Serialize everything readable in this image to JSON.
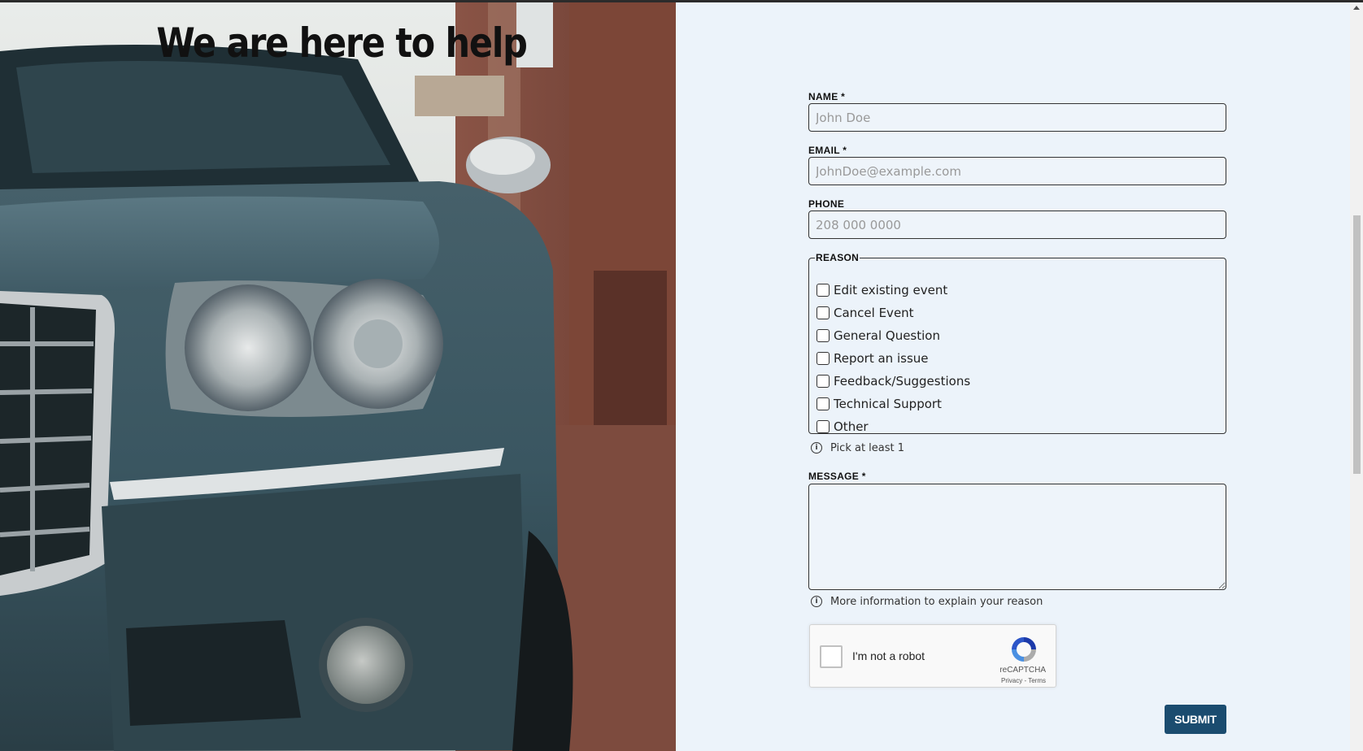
{
  "form": {
    "title": "We are here to help",
    "name_label": "NAME *",
    "name_placeholder": "John Doe",
    "email_label": "EMAIL *",
    "email_placeholder": "JohnDoe@example.com",
    "phone_label": "PHONE",
    "phone_placeholder": "208 000 0000",
    "reason_legend": "REASON",
    "reasons": [
      "Edit existing event",
      "Cancel Event",
      "General Question",
      "Report an issue",
      "Feedback/Suggestions",
      "Technical Support",
      "Other"
    ],
    "reason_hint": "Pick at least 1",
    "message_label": "MESSAGE *",
    "message_hint": "More information to explain your reason",
    "submit_label": "SUBMIT"
  },
  "captcha": {
    "label": "I'm not a robot",
    "brand": "reCAPTCHA",
    "links": "Privacy - Terms"
  },
  "colors": {
    "panel_bg": "#ecf3fa",
    "submit_bg": "#1b4c6f"
  },
  "photo": {
    "icon": "car-photo"
  }
}
